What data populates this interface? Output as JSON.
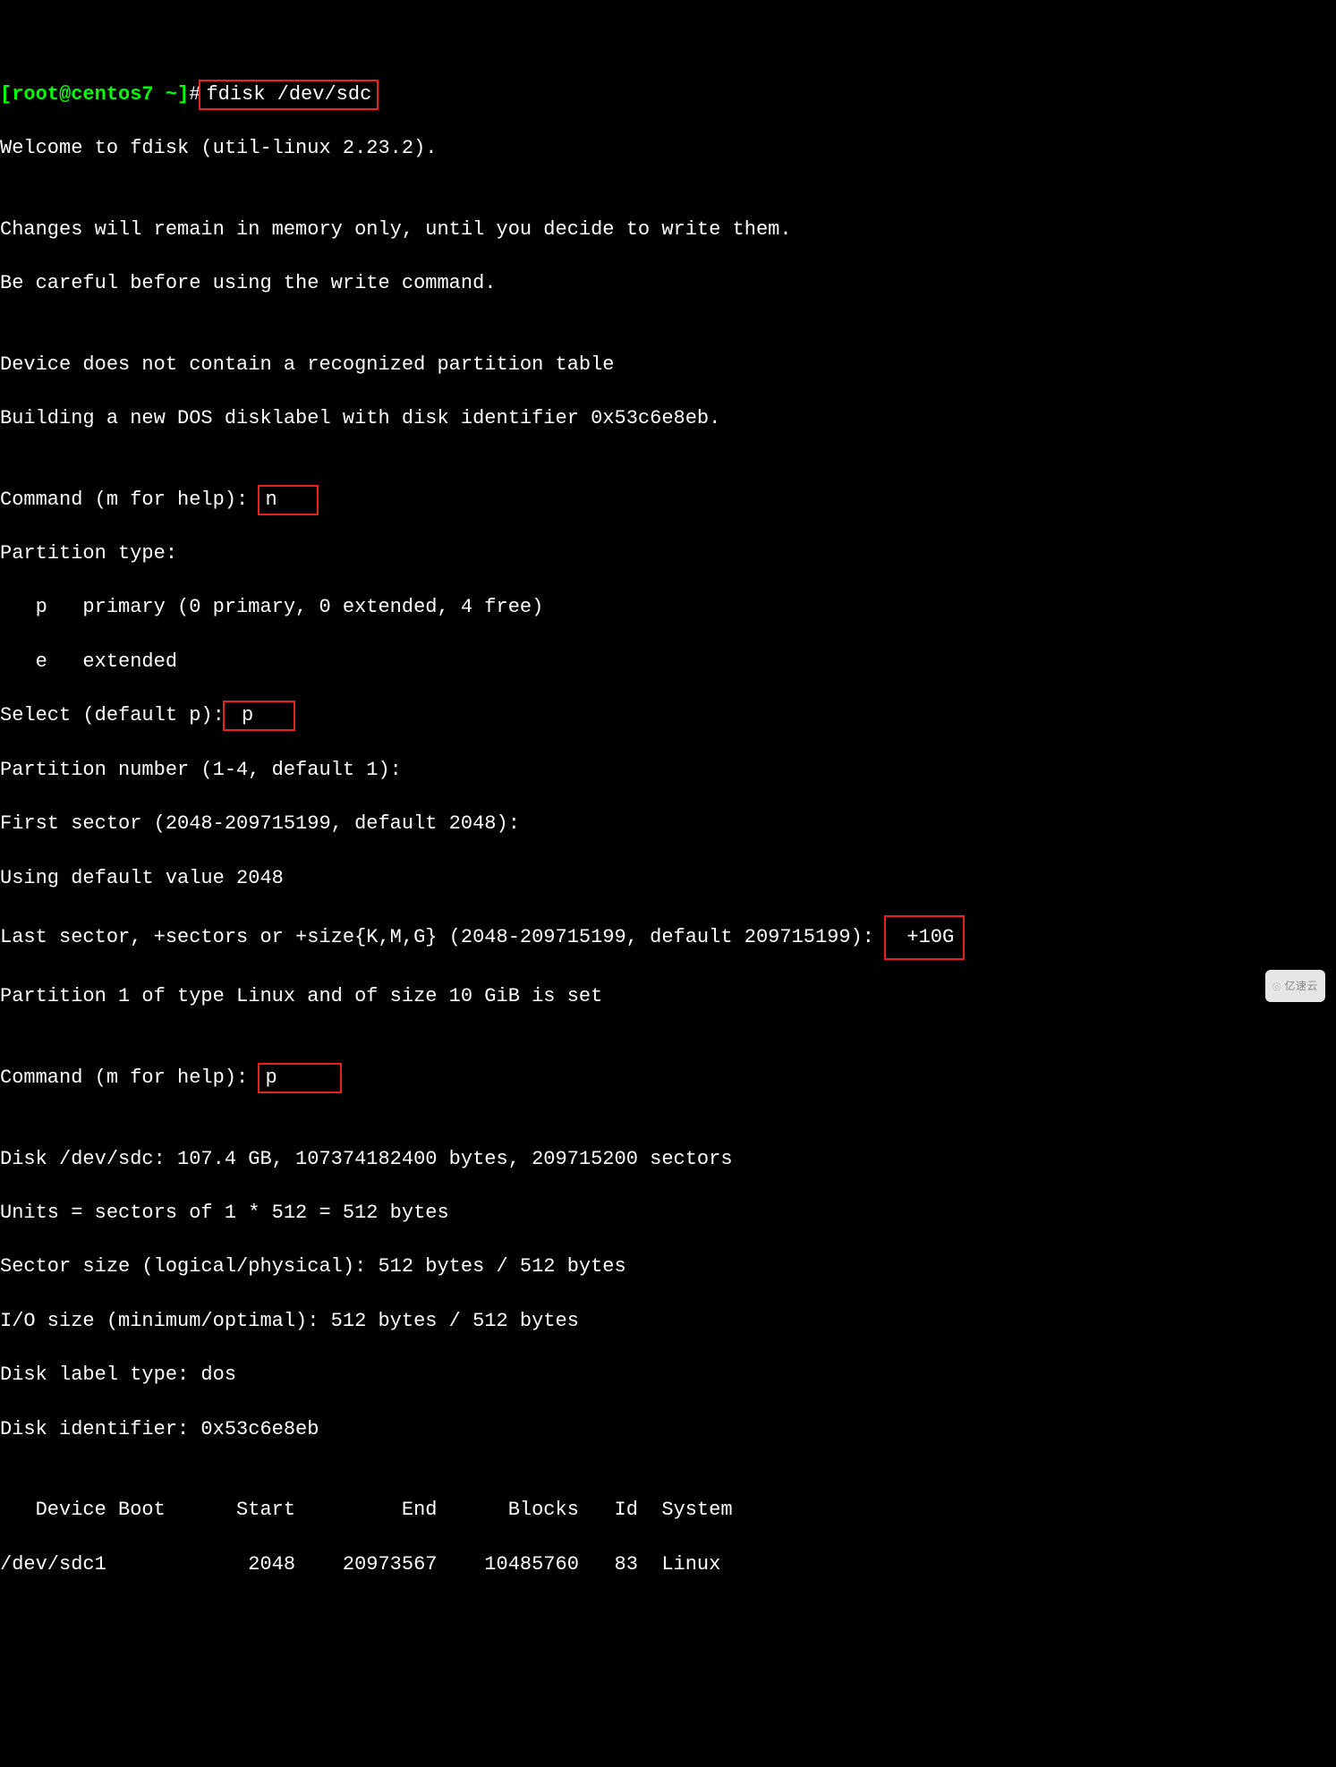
{
  "prompt": {
    "user_host": "[root@centos7 ~]",
    "hash": "#",
    "command": "fdisk /dev/sdc"
  },
  "welcome": "Welcome to fdisk (util-linux 2.23.2).",
  "blank": "",
  "changes_line": "Changes will remain in memory only, until you decide to write them.",
  "careful_line": "Be careful before using the write command.",
  "device_notable": "Device does not contain a recognized partition table",
  "building_line": "Building a new DOS disklabel with disk identifier 0x53c6e8eb.",
  "cmd_prompt_1": "Command (m for help): ",
  "input_n": "n  ",
  "ptype_header": "Partition type:",
  "ptype_primary": "   p   primary (0 primary, 0 extended, 4 free)",
  "ptype_extended": "   e   extended",
  "select_default_pre": "Select (default p):",
  "input_p1": " p  ",
  "part_number": "Partition number (1-4, default 1): ",
  "first_sector": "First sector (2048-209715199, default 2048): ",
  "using_default": "Using default value 2048",
  "last_sector_pre": "Last sector, +sectors or +size{K,M,G} (2048-209715199, default 209715199):",
  "input_10g": " +10G",
  "part1_set": "Partition 1 of type Linux and of size 10 GiB is set",
  "cmd_prompt_2": "Command (m for help): ",
  "input_p2": "p    ",
  "disk_line": "Disk /dev/sdc: 107.4 GB, 107374182400 bytes, 209715200 sectors",
  "units_line": "Units = sectors of 1 * 512 = 512 bytes",
  "sector_size": "Sector size (logical/physical): 512 bytes / 512 bytes",
  "io_size": "I/O size (minimum/optimal): 512 bytes / 512 bytes",
  "disk_label": "Disk label type: dos",
  "disk_id": "Disk identifier: 0x53c6e8eb",
  "table_header": "   Device Boot      Start         End      Blocks   Id  System",
  "table_row1": "/dev/sdc1            2048    20973567    10485760   83  Linux",
  "watermark": "亿速云"
}
